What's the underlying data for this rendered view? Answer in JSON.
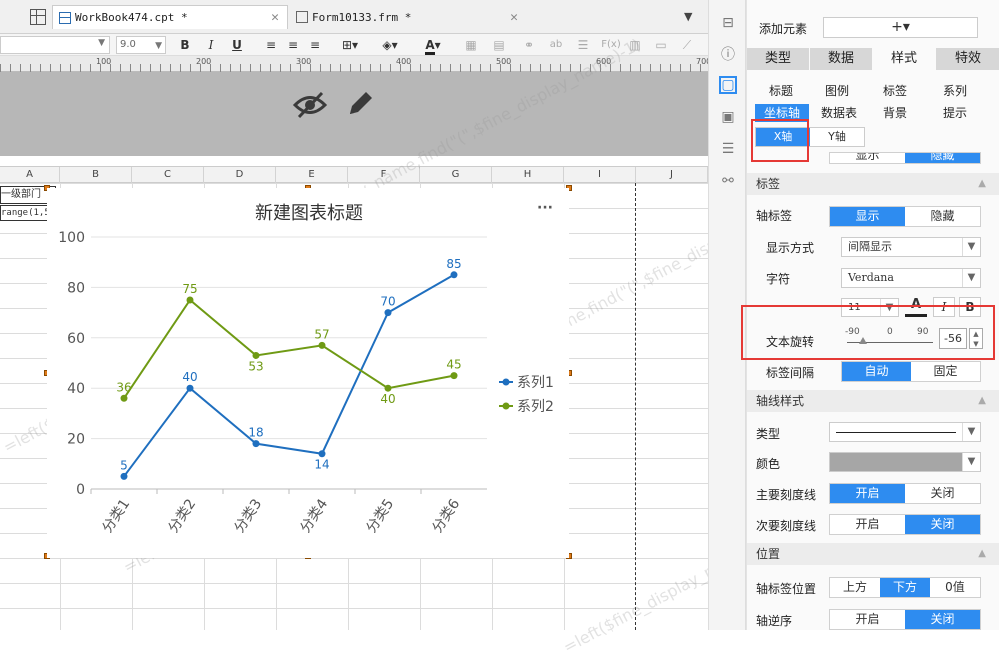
{
  "tabs": [
    {
      "name": "WorkBook474.cpt *"
    },
    {
      "name": "Form10133.frm *"
    }
  ],
  "toolbar": {
    "font_size": "9.0",
    "bold": "B",
    "italic": "I",
    "underline": "U",
    "font_color": "A",
    "more": "ab",
    "formula": "F(x)"
  },
  "ruler": {
    "marks": [
      "100",
      "200",
      "300",
      "400",
      "500",
      "600",
      "700"
    ]
  },
  "columns": [
    "A",
    "B",
    "C",
    "D",
    "E",
    "F",
    "G",
    "H",
    "I",
    "J"
  ],
  "cells": {
    "a1": "一级部门",
    "a2": "range(1,5"
  },
  "watermark": "=left($fine_display_name,find(\"(\",$fine_display_name)-1)",
  "chart_data": {
    "type": "line",
    "title": "新建图表标题",
    "categories": [
      "分类1",
      "分类2",
      "分类3",
      "分类4",
      "分类5",
      "分类6"
    ],
    "series": [
      {
        "name": "系列1",
        "color": "#1f6fbf",
        "values": [
          5,
          40,
          18,
          14,
          70,
          85
        ]
      },
      {
        "name": "系列2",
        "color": "#6f9a14",
        "values": [
          36,
          75,
          53,
          57,
          40,
          45
        ]
      }
    ],
    "ylim": [
      0,
      100
    ],
    "yticks": [
      "0",
      "20",
      "40",
      "60",
      "80",
      "100"
    ],
    "grid": true,
    "legend": "right",
    "xlabel_rotation": -56,
    "more_label": "···"
  },
  "panel": {
    "add_element_label": "添加元素",
    "add_symbol": "+▾",
    "main_tabs": [
      "类型",
      "数据",
      "样式",
      "特效"
    ],
    "sub_tabs": [
      "标题",
      "图例",
      "标签",
      "系列",
      "坐标轴",
      "数据表",
      "背景",
      "提示"
    ],
    "axis_tabs": [
      "X轴",
      "Y轴"
    ],
    "show_labels": {
      "show": "显示",
      "hide": "隐藏"
    },
    "section_label": "标签",
    "axis_label": {
      "label": "轴标签",
      "show": "显示",
      "hide": "隐藏"
    },
    "display_mode": {
      "label": "显示方式",
      "value": "间隔显示"
    },
    "char": {
      "label": "字符",
      "font": "Verdana",
      "size": "11",
      "color_icon": "A",
      "italic": "I",
      "bold": "B"
    },
    "rotation": {
      "label": "文本旋转",
      "min": "-90",
      "mid": "0",
      "max": "90",
      "value": "-56",
      "slider_level": -56
    },
    "label_interval": {
      "label": "标签间隔",
      "auto": "自动",
      "fixed": "固定"
    },
    "axis_style_section": "轴线样式",
    "line_type": {
      "label": "类型"
    },
    "line_color": {
      "label": "颜色",
      "value": "#a6a6a6"
    },
    "major_tick": {
      "label": "主要刻度线",
      "on": "开启",
      "off": "关闭"
    },
    "minor_tick": {
      "label": "次要刻度线",
      "on": "开启",
      "off": "关闭"
    },
    "position_section": "位置",
    "label_position": {
      "label": "轴标签位置",
      "top": "上方",
      "bottom": "下方",
      "zero": "0值"
    },
    "reverse": {
      "label": "轴逆序",
      "on": "开启",
      "off": "关闭"
    }
  },
  "colors": {
    "accent": "#2e8cf0",
    "highlight": "#e53935"
  }
}
